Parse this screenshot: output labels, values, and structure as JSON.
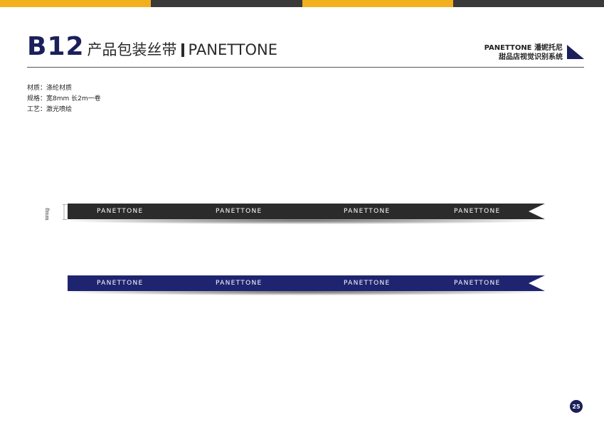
{
  "colors": {
    "topbar": [
      "#f2b01e",
      "#3a3a3a",
      "#f2b01e",
      "#3a3a3a"
    ],
    "navy": "#1b1f5a",
    "ribbon_black": "#2b2b2b",
    "ribbon_navy": "#1f2470"
  },
  "header": {
    "code": "B12",
    "title": "产品包装丝带",
    "brand": "PANETTONE",
    "right_line1": "PANETTONE 潘妮托尼",
    "right_line2": "甜品店视觉识别系统"
  },
  "specs": [
    "材质：涤纶材质",
    "规格：宽8mm 长2m一卷",
    "工艺：激光喷绘"
  ],
  "dimension_label": "8mm",
  "ribbons": [
    {
      "color": "#2b2b2b",
      "logos": [
        "PANETTONE",
        "PANETTONE",
        "PANETTONE",
        "PANETTONE"
      ]
    },
    {
      "color": "#1f2470",
      "logos": [
        "PANETTONE",
        "PANETTONE",
        "PANETTONE",
        "PANETTONE"
      ]
    }
  ],
  "page_number": "25"
}
